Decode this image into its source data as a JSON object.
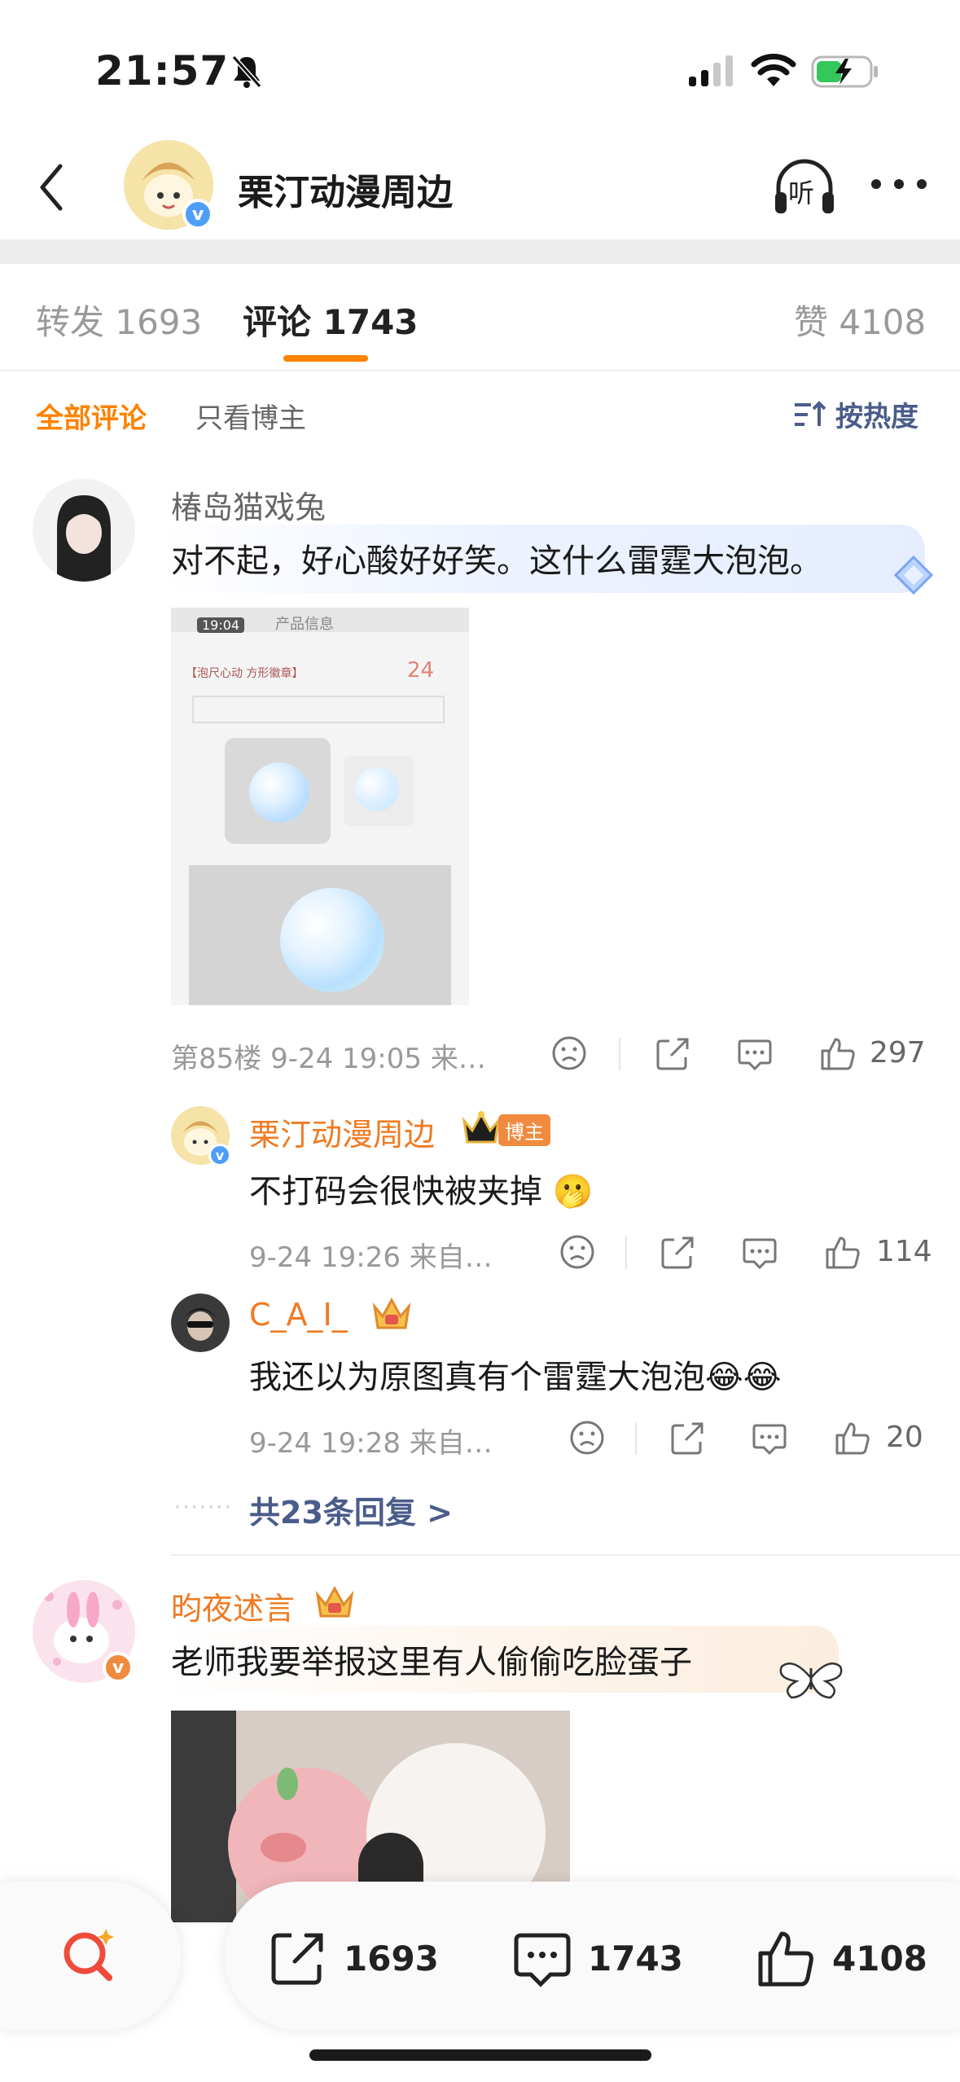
{
  "status_bar": {
    "time": "21:57"
  },
  "nav": {
    "title": "栗汀动漫周边",
    "listen_label": "听"
  },
  "tabs": {
    "repost": "转发 1693",
    "comments": "评论 1743",
    "likes": "赞 4108"
  },
  "filters": {
    "all": "全部评论",
    "author_only": "只看博主",
    "sort": "按热度"
  },
  "comments": [
    {
      "username": "椿岛猫戏兔",
      "text": "对不起，好心酸好好笑。这什么雷霆大泡泡。",
      "image": {
        "time": "19:04",
        "title": "产品信息",
        "price": "24",
        "product_name": "【泡尺心动 方形徽章】"
      },
      "meta": "第85楼 9-24 19:05 来…",
      "likes": "297",
      "replies": [
        {
          "username": "栗汀动漫周边",
          "badge": "博主",
          "text": "不打码会很快被夹掉 🫢",
          "meta": "9-24 19:26 来自…",
          "likes": "114"
        },
        {
          "username": "C_A_I_",
          "text": "我还以为原图真有个雷霆大泡泡😂😂",
          "meta": "9-24 19:28 来自…",
          "likes": "20"
        }
      ],
      "more_replies": "共23条回复 >"
    },
    {
      "username": "昀夜述言",
      "text": "老师我要举报这里有人偷偷吃脸蛋子"
    }
  ],
  "bottom_bar": {
    "repost_count": "1693",
    "comment_count": "1743",
    "like_count": "4108"
  },
  "colors": {
    "accent": "#ff8200",
    "link": "#4a5c8a",
    "verified": "#4e9ef7"
  }
}
